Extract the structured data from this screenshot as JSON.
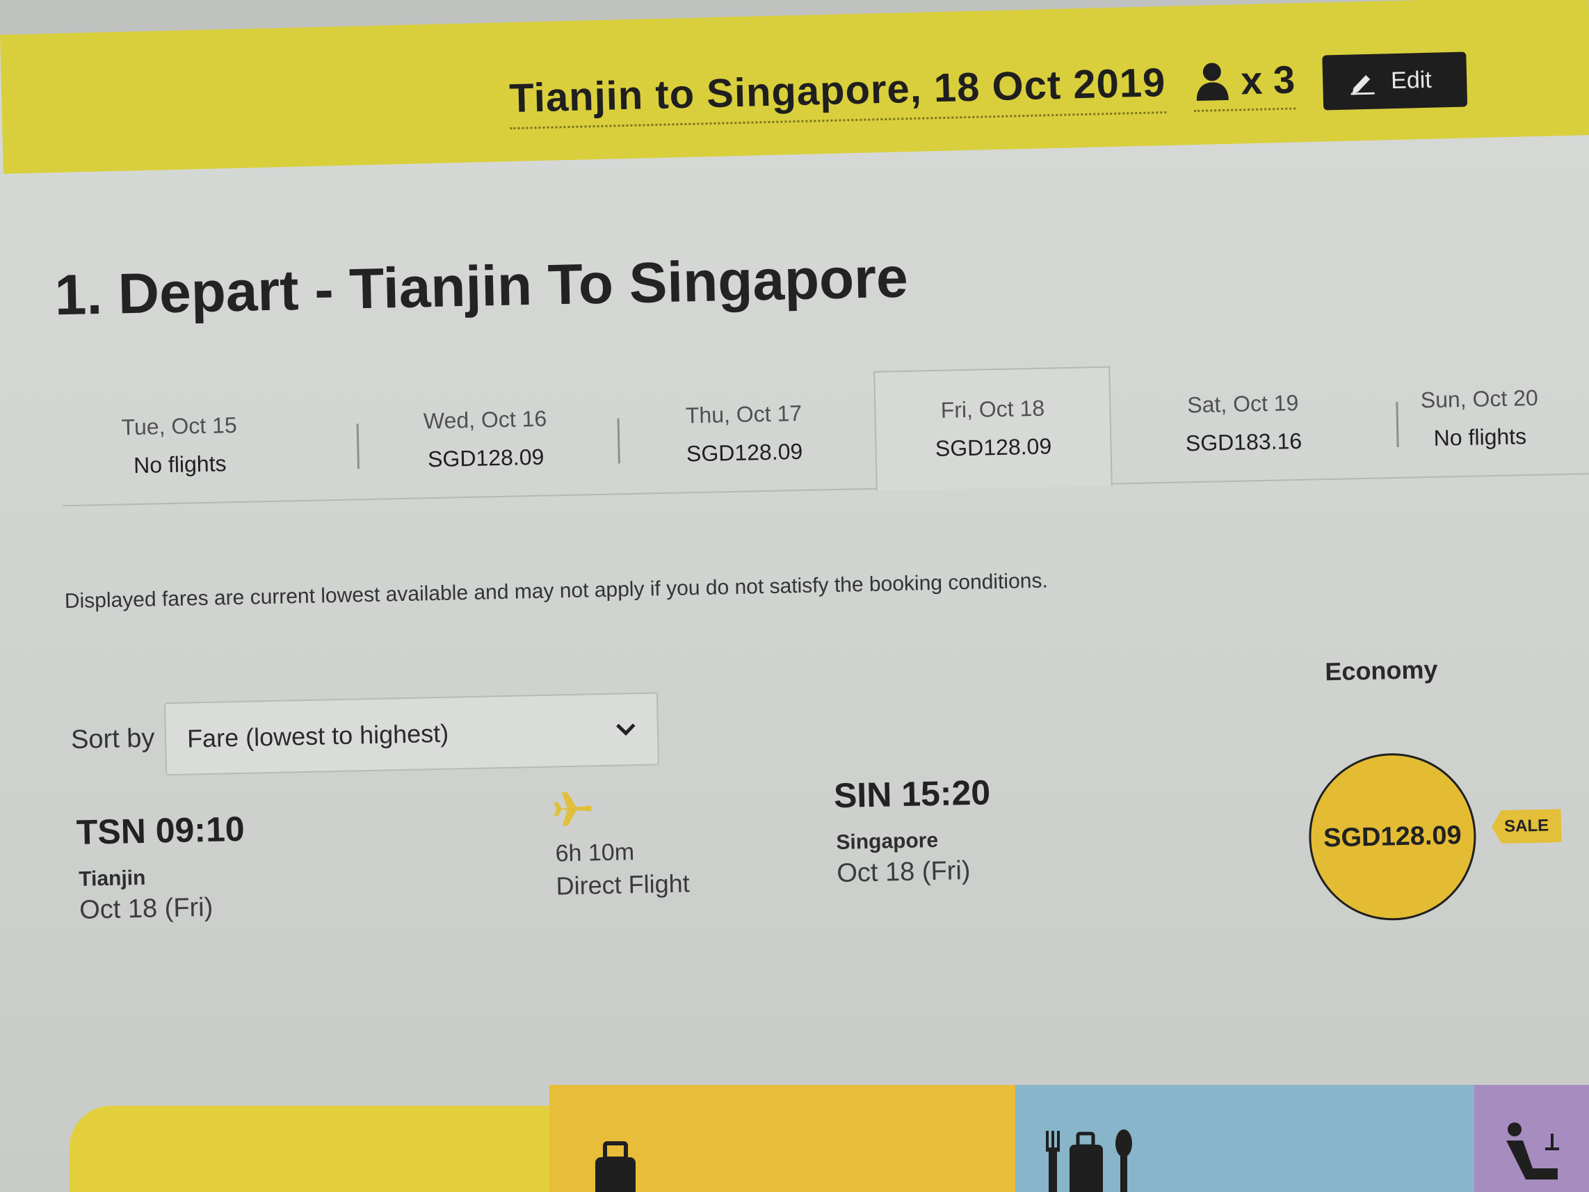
{
  "header": {
    "route_title": "Tianjin to Singapore, 18 Oct 2019",
    "passenger_count": "x 3",
    "edit_label": "Edit"
  },
  "page_title": "1. Depart - Tianjin To Singapore",
  "date_tabs": [
    {
      "date": "Tue, Oct 15",
      "price": "No flights"
    },
    {
      "date": "Wed, Oct 16",
      "price": "SGD128.09"
    },
    {
      "date": "Thu, Oct 17",
      "price": "SGD128.09"
    },
    {
      "date": "Fri, Oct 18",
      "price": "SGD128.09"
    },
    {
      "date": "Sat, Oct 19",
      "price": "SGD183.16"
    },
    {
      "date": "Sun, Oct 20",
      "price": "No flights"
    }
  ],
  "disclaimer": "Displayed fares are current lowest available and may not apply if you do not satisfy the booking conditions.",
  "cabin": "Economy",
  "sort": {
    "label": "Sort by",
    "selected": "Fare (lowest to highest)"
  },
  "flight": {
    "departure": {
      "code_time": "TSN 09:10",
      "city": "Tianjin",
      "date": "Oct 18 (Fri)"
    },
    "duration": "6h 10m",
    "type": "Direct Flight",
    "arrival": {
      "code_time": "SIN 15:20",
      "city": "Singapore",
      "date": "Oct 18 (Fri)"
    },
    "fare": "SGD128.09",
    "badge": "SALE"
  },
  "icons": [
    "person-icon",
    "pencil-icon",
    "chevron-down-icon",
    "plane-icon",
    "luggage-icon",
    "meal-luggage-icon",
    "seat-icon"
  ],
  "colors": {
    "header_yellow": "#d9cf3c",
    "fare_gold": "#e4bc34",
    "button_dark": "#1e1e1e",
    "panel_blue": "#88b5c9",
    "panel_purple": "#a78cc0"
  }
}
